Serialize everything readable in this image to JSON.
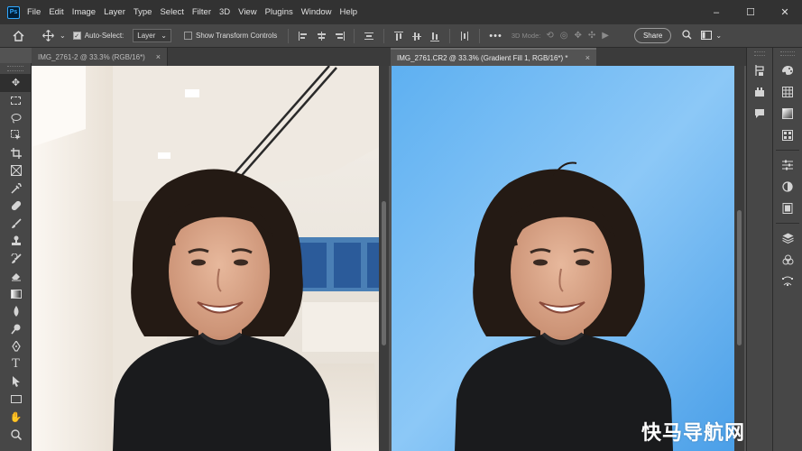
{
  "app": {
    "logo": "Ps"
  },
  "menu": [
    "File",
    "Edit",
    "Image",
    "Layer",
    "Type",
    "Select",
    "Filter",
    "3D",
    "View",
    "Plugins",
    "Window",
    "Help"
  ],
  "window_controls": {
    "minimize": "–",
    "maximize": "☐",
    "close": "✕"
  },
  "options": {
    "auto_select_label": "Auto-Select:",
    "auto_select_checked": true,
    "auto_select_value": "Layer",
    "transform_label": "Show Transform Controls",
    "transform_checked": false,
    "more": "•••",
    "mode_3d_label": "3D Mode:",
    "share_label": "Share"
  },
  "tabs": [
    {
      "title": "IMG_2761-2 @ 33.3% (RGB/16*)",
      "close": "×",
      "active": false
    },
    {
      "title": "IMG_2761.CR2 @ 33.3% (Gradient Fill 1, RGB/16*) *",
      "close": "×",
      "active": true
    }
  ],
  "tools": [
    "move-icon",
    "marquee-icon",
    "lasso-icon",
    "object-select-icon",
    "crop-icon",
    "frame-icon",
    "eyedropper-icon",
    "healing-brush-icon",
    "brush-icon",
    "clone-stamp-icon",
    "history-brush-icon",
    "eraser-icon",
    "gradient-icon",
    "blur-icon",
    "dodge-icon",
    "pen-icon",
    "type-icon",
    "path-select-icon",
    "rectangle-icon",
    "hand-icon",
    "zoom-icon"
  ],
  "panels_col1": [
    "history-icon",
    "actions-icon",
    "comments-icon"
  ],
  "panels_col2": [
    "color-icon",
    "swatches-icon",
    "gradients-icon",
    "patterns-icon",
    "adjustments-icon",
    "properties-icon",
    "libraries-icon",
    "layers-icon",
    "channels-icon",
    "paths-icon"
  ],
  "watermark": "快马导航网",
  "colors": {
    "chrome_dark": "#323232",
    "panel": "#474747",
    "workspace": "#535353",
    "sky": "#6bb7f2",
    "sweater": "#1a1b1d"
  }
}
